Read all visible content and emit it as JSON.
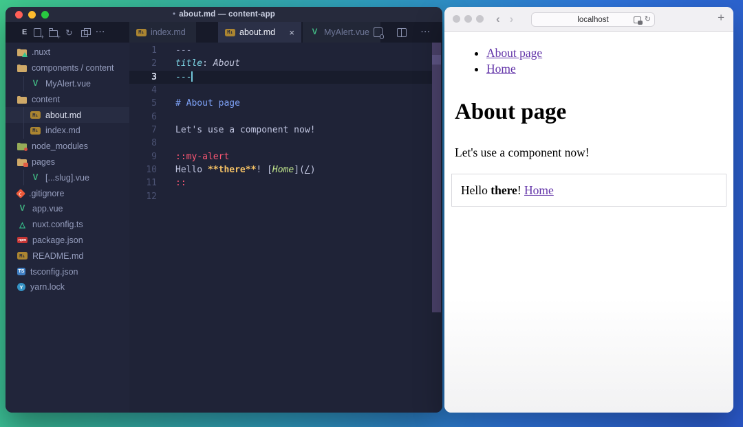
{
  "colors": {
    "accent_purple_scrollbar": "#4a4169",
    "vue_green": "#41b883",
    "markdown_amber": "#ab8531",
    "link_purple": "#6233a8",
    "desktop_green": "#41cb8e",
    "desktop_blue": "#2a57c7"
  },
  "icons": {
    "close": "×",
    "more": "···",
    "refresh": "↻",
    "reload": "↻",
    "back": "‹",
    "forward": "›",
    "new_tab": "+",
    "markdown": "M↓",
    "vue": "V",
    "ts": "TS",
    "npm": "npm",
    "yarn": "Y",
    "nuxt": "△"
  },
  "vscode": {
    "titlebar": {
      "edited_dot": "•",
      "title": "about.md — content-app"
    },
    "explorer": {
      "header_label": "E",
      "files": [
        {
          "label": ".nuxt",
          "icon": "folder-nuxt",
          "indent": 0
        },
        {
          "label": "components / content",
          "icon": "folder",
          "indent": 0
        },
        {
          "label": "MyAlert.vue",
          "icon": "vue",
          "indent": 1
        },
        {
          "label": "content",
          "icon": "folder",
          "indent": 0
        },
        {
          "label": "about.md",
          "icon": "markdown",
          "indent": 1,
          "selected": true
        },
        {
          "label": "index.md",
          "icon": "markdown",
          "indent": 1
        },
        {
          "label": "node_modules",
          "icon": "folder-node",
          "indent": 0
        },
        {
          "label": "pages",
          "icon": "folder-pages",
          "indent": 0
        },
        {
          "label": "[...slug].vue",
          "icon": "vue",
          "indent": 1
        },
        {
          "label": ".gitignore",
          "icon": "git",
          "indent": 0
        },
        {
          "label": "app.vue",
          "icon": "vue",
          "indent": 0
        },
        {
          "label": "nuxt.config.ts",
          "icon": "nuxt-config",
          "indent": 0
        },
        {
          "label": "package.json",
          "icon": "npm",
          "indent": 0
        },
        {
          "label": "README.md",
          "icon": "markdown",
          "indent": 0
        },
        {
          "label": "tsconfig.json",
          "icon": "ts",
          "indent": 0
        },
        {
          "label": "yarn.lock",
          "icon": "yarn",
          "indent": 0
        }
      ]
    },
    "tabs": [
      {
        "label": "index.md",
        "icon": "markdown",
        "active": false,
        "close": false
      },
      {
        "label": "about.md",
        "icon": "markdown",
        "active": true,
        "close": true
      },
      {
        "label": "MyAlert.vue",
        "icon": "vue",
        "active": false,
        "close": false
      }
    ],
    "editor": {
      "active_line": 3,
      "lines": [
        {
          "n": 1,
          "t": [
            [
              "---",
              "dim"
            ]
          ]
        },
        {
          "n": 2,
          "t": [
            [
              "title",
              "cyi"
            ],
            [
              ": ",
              "fg"
            ],
            [
              "About",
              "fgi"
            ]
          ]
        },
        {
          "n": 3,
          "t": [
            [
              "---",
              "cy"
            ]
          ],
          "cursor": true
        },
        {
          "n": 4,
          "t": []
        },
        {
          "n": 5,
          "t": [
            [
              "# About page",
              "blue"
            ]
          ]
        },
        {
          "n": 6,
          "t": []
        },
        {
          "n": 7,
          "t": [
            [
              "Let's use a component now!",
              "fg"
            ]
          ]
        },
        {
          "n": 8,
          "t": []
        },
        {
          "n": 9,
          "t": [
            [
              "::my-alert",
              "red"
            ]
          ]
        },
        {
          "n": 10,
          "t": [
            [
              "Hello ",
              "fg"
            ],
            [
              "**there**",
              "yel"
            ],
            [
              "! [",
              "fg"
            ],
            [
              "Home",
              "grn"
            ],
            [
              "](",
              "fg"
            ],
            [
              "/",
              "und"
            ],
            [
              ")",
              "fg"
            ]
          ]
        },
        {
          "n": 11,
          "t": [
            [
              "::",
              "red"
            ]
          ]
        },
        {
          "n": 12,
          "t": []
        }
      ]
    }
  },
  "browser": {
    "url": "localhost",
    "nav_list": [
      {
        "label": "About page"
      },
      {
        "label": "Home"
      }
    ],
    "heading": "About page",
    "paragraph": "Let's use a component now!",
    "alert": {
      "prefix": "Hello ",
      "bold": "there",
      "mid": "! ",
      "link": "Home"
    }
  }
}
